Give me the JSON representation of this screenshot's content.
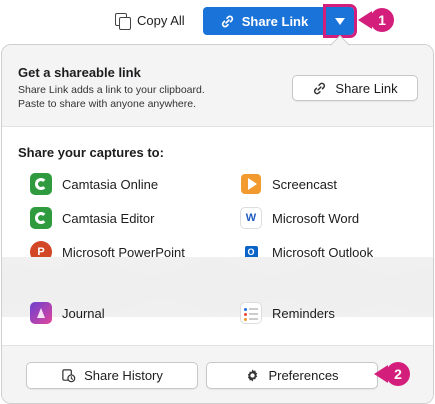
{
  "toolbar": {
    "copy_all_label": "Copy All",
    "share_link_label": "Share Link",
    "accent": "#1a73d9"
  },
  "callouts": {
    "first": "1",
    "second": "2",
    "color": "#d41e7b"
  },
  "share_panel": {
    "title": "Get a shareable link",
    "description_line1": "Share Link adds a link to your clipboard.",
    "description_line2": "Paste to share with anyone anywhere.",
    "share_button_label": "Share Link"
  },
  "captures": {
    "heading": "Share your captures to:",
    "destinations": [
      {
        "label": "Camtasia Online",
        "icon": "camtasia-icon"
      },
      {
        "label": "Screencast",
        "icon": "screencast-icon"
      },
      {
        "label": "Camtasia Editor",
        "icon": "camtasia-icon"
      },
      {
        "label": "Microsoft Word",
        "icon": "word-icon"
      },
      {
        "label": "Microsoft PowerPoint",
        "icon": "powerpoint-icon"
      },
      {
        "label": "Microsoft Outlook",
        "icon": "outlook-icon"
      },
      {
        "label": "Journal",
        "icon": "journal-icon"
      },
      {
        "label": "Reminders",
        "icon": "reminders-icon"
      }
    ]
  },
  "footer": {
    "share_history_label": "Share History",
    "preferences_label": "Preferences"
  }
}
